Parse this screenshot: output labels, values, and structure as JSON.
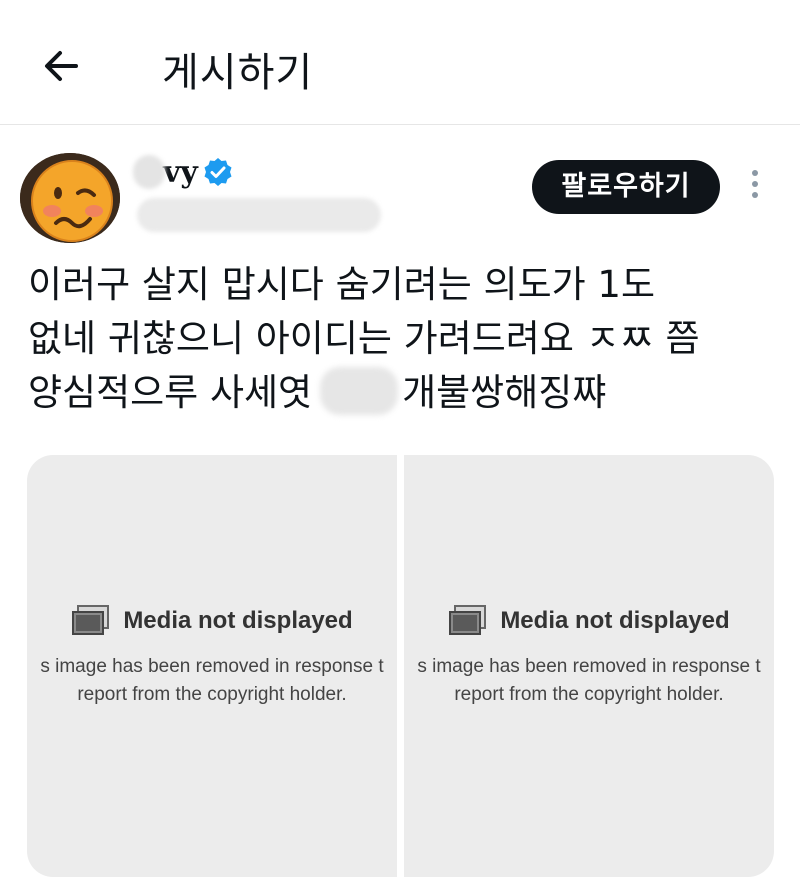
{
  "header": {
    "title": "게시하기"
  },
  "author": {
    "name_fragment": "vy",
    "follow_label": "팔로우하기"
  },
  "post": {
    "line1": "이러구 살지 맙시다 숨기려는 의도가 1도",
    "line2": "없네 귀찮으니 아이디는 가려드려요 ㅈㅉ  쯤",
    "line3a": "양심적으루 사세엿",
    "line3b": "개불쌍해징쨔"
  },
  "media": [
    {
      "title": "Media not displayed",
      "desc1": "s image has been removed in response t",
      "desc2": "report from the copyright holder."
    },
    {
      "title": "Media not displayed",
      "desc1": "s image has been removed in response t",
      "desc2": "report from the copyright holder."
    }
  ],
  "colors": {
    "verified": "#1d9bf0",
    "button_bg": "#0f1419",
    "media_bg": "#ececec"
  },
  "icons": {
    "back": "arrow-left-icon",
    "verified": "verified-badge-icon",
    "more": "more-vertical-icon",
    "media": "image-placeholder-icon"
  }
}
